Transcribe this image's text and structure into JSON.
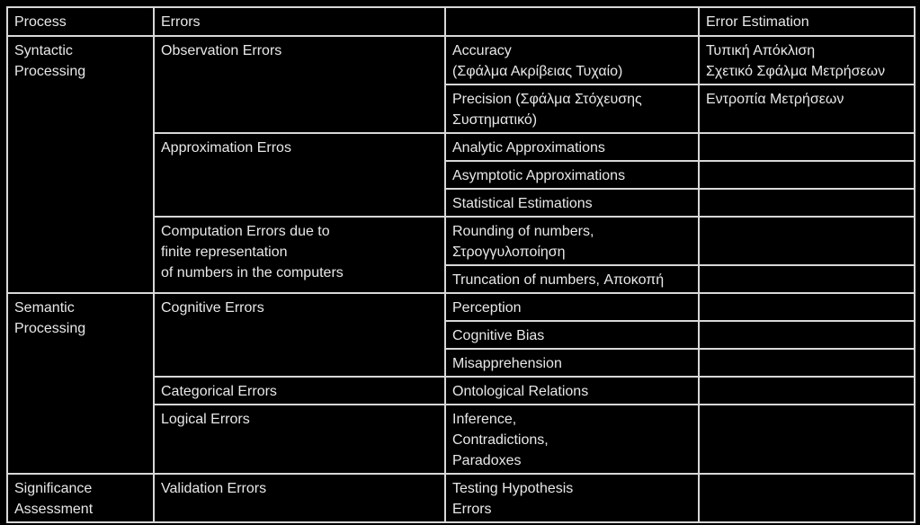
{
  "header": {
    "process": "Process",
    "errors": "Errors",
    "subtype": "",
    "estimation": "Error Estimation"
  },
  "rows": {
    "syntactic": {
      "process": "Syntactic\nProcessing",
      "observation": {
        "label": "Observation Errors",
        "items": [
          {
            "name": "Accuracy\n(Σφάλμα Ακρίβειας Τυχαίο)",
            "estimation": "Τυπική Απόκλιση\nΣχετικό Σφάλμα Μετρήσεων"
          },
          {
            "name": "Precision (Σφάλμα Στόχευσης\nΣυστηματικό)",
            "estimation": "Εντροπία Μετρήσεων"
          }
        ]
      },
      "approximation": {
        "label": "Approximation Erros",
        "items": [
          {
            "name": "Analytic Approximations",
            "estimation": ""
          },
          {
            "name": "Asymptotic Approximations",
            "estimation": ""
          },
          {
            "name": "Statistical Estimations",
            "estimation": ""
          }
        ]
      },
      "computation": {
        "label": "Computation Errors due to\n finite representation\n of numbers in the computers",
        "items": [
          {
            "name": "Rounding of numbers,\nΣτρογγυλοποίηση",
            "estimation": ""
          },
          {
            "name": "Truncation of numbers, Αποκοπή",
            "estimation": ""
          }
        ]
      }
    },
    "semantic": {
      "process": "Semantic\nProcessing",
      "cognitive": {
        "label": "Cognitive Errors",
        "items": [
          {
            "name": "Perception",
            "estimation": ""
          },
          {
            "name": "Cognitive Bias",
            "estimation": ""
          },
          {
            "name": "Misapprehension",
            "estimation": ""
          }
        ]
      },
      "categorical": {
        "label": "Categorical Errors",
        "items": [
          {
            "name": "Ontological Relations",
            "estimation": ""
          }
        ]
      },
      "logical": {
        "label": "Logical Errors",
        "items": [
          {
            "name": "Inference,\nContradictions,\nParadoxes",
            "estimation": ""
          }
        ]
      }
    },
    "significance": {
      "process": "Significance\nAssessment",
      "validation": {
        "label": "Validation Errors",
        "items": [
          {
            "name": "Testing Hypothesis\nErrors",
            "estimation": ""
          }
        ]
      }
    }
  }
}
